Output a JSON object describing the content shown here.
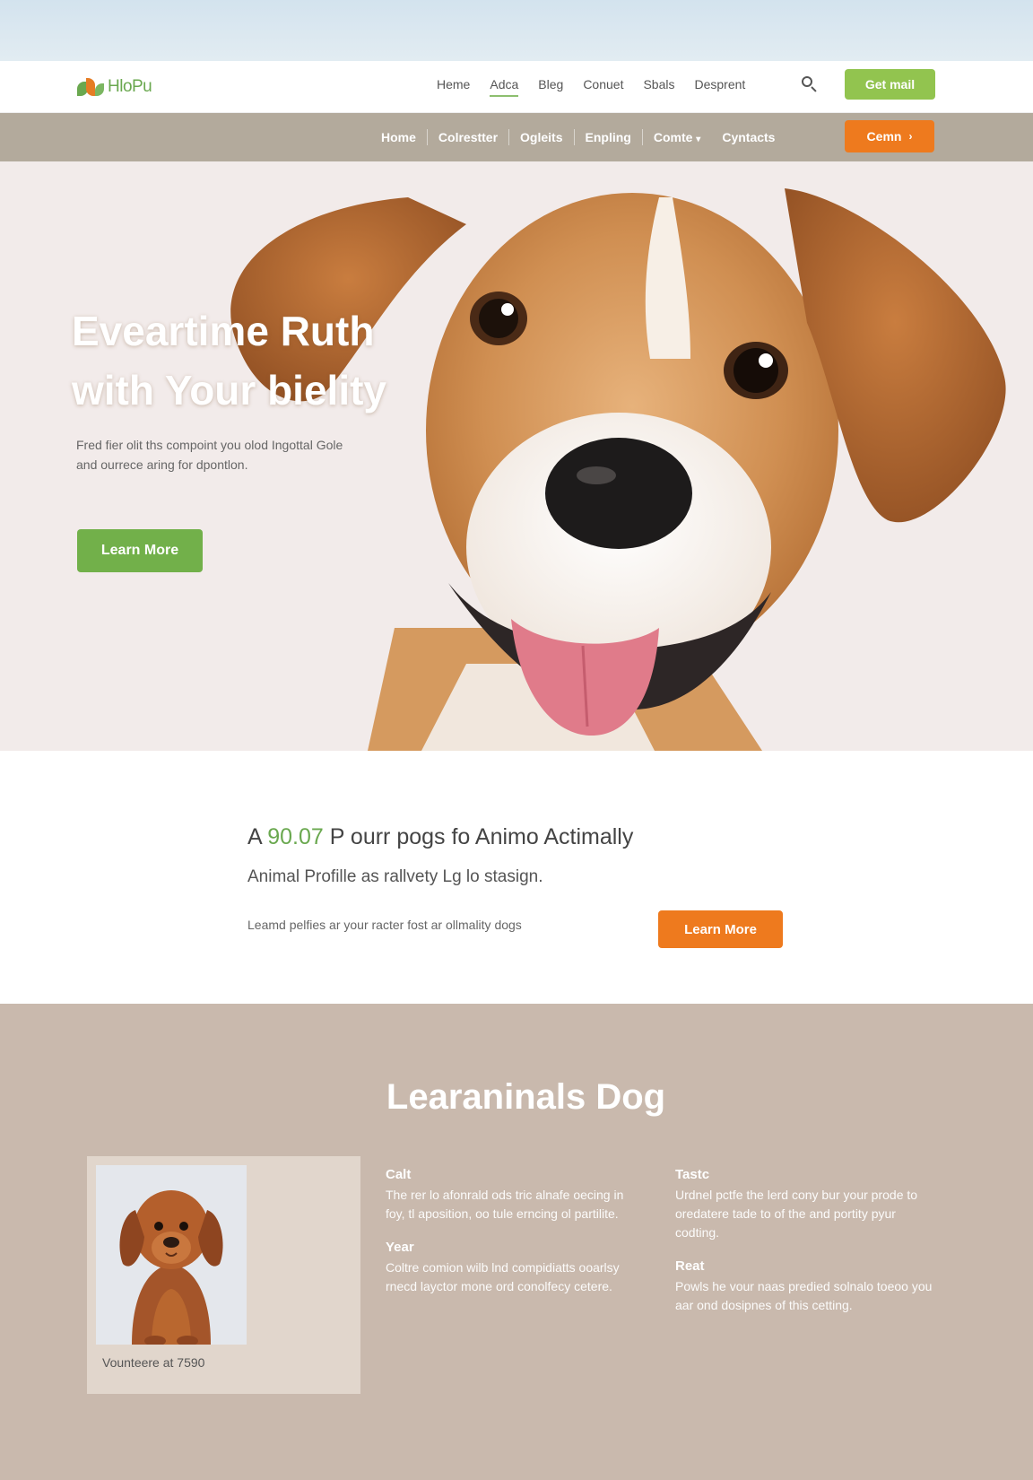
{
  "header": {
    "logo_text": "HloPu",
    "nav": [
      "Heme",
      "Adca",
      "Bleg",
      "Conuet",
      "Sbals",
      "Desprent"
    ],
    "cta": "Get mail"
  },
  "subnav": {
    "items": [
      "Home",
      "Colrestter",
      "Ogleits",
      "Enpling",
      "Comte",
      "Cyntacts"
    ],
    "cta": "Cemn"
  },
  "hero": {
    "title_line1": "Eveartime Ruth",
    "title_line2": "with Your bielity",
    "desc_line1": "Fred fier olit ths compoint you olod Ingottal Gole",
    "desc_line2": "and ourrece aring for dpontlon.",
    "button": "Learn More"
  },
  "promo": {
    "title_pre": "A ",
    "title_accent": "90.07",
    "title_post": " P ourr pogs fo Animo Actimally",
    "subtitle": "Animal Profille as rallvety Lg lo stasign.",
    "desc": "Leamd pelfies ar your racter fost ar ollmality dogs",
    "button": "Learn More"
  },
  "learn": {
    "title": "Learaninals Dog",
    "caption": "Vounteere at 7590",
    "blocks": [
      {
        "heading": "Calt",
        "text": "The rer lo afonrald ods tric alnafe oecing in foy, tl aposition, oo tule erncing ol partilite."
      },
      {
        "heading": "Tastc",
        "text": "Urdnel pctfe the lerd cony bur your prode to oredatere tade to of the and portity pyur codting."
      },
      {
        "heading": "Year",
        "text": "Coltre comion wilb lnd compidiatts ooarlsy rnecd layctor mone ord conolfecy cetere."
      },
      {
        "heading": "Reat",
        "text": "Powls he vour naas predied solnalo toeoo you aar ond dosipnes of this cetting."
      }
    ]
  },
  "colors": {
    "accent_green": "#92c44f",
    "accent_orange": "#ee7a1e",
    "subnav_bg": "#b3aa9c",
    "section_bg": "#c9b9ad"
  },
  "icons": [
    "search-icon",
    "chevron-down-icon",
    "arrow-right-icon",
    "logo-mark-icon"
  ]
}
